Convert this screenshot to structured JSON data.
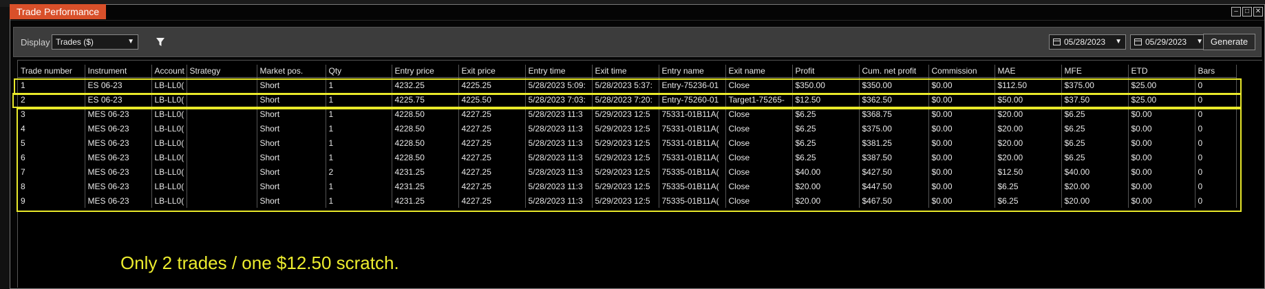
{
  "window": {
    "title": "Trade Performance"
  },
  "toolbar": {
    "display_label": "Display",
    "display_value": "Trades ($)",
    "filter_icon": "filter-icon",
    "date_from": "05/28/2023",
    "date_to": "05/29/2023",
    "generate_label": "Generate"
  },
  "table": {
    "columns": [
      "Trade number",
      "Instrument",
      "Account",
      "Strategy",
      "Market pos.",
      "Qty",
      "Entry price",
      "Exit price",
      "Entry time",
      "Exit time",
      "Entry name",
      "Exit name",
      "Profit",
      "Cum. net profit",
      "Commission",
      "MAE",
      "MFE",
      "ETD",
      "Bars"
    ],
    "rows": [
      [
        "1",
        "ES 06-23",
        "LB-LL0(",
        "",
        "Short",
        "1",
        "4232.25",
        "4225.25",
        "5/28/2023 5:09:",
        "5/28/2023 5:37:",
        "Entry-75236-01",
        "Close",
        "$350.00",
        "$350.00",
        "$0.00",
        "$112.50",
        "$375.00",
        "$25.00",
        "0"
      ],
      [
        "2",
        "ES 06-23",
        "LB-LL0(",
        "",
        "Short",
        "1",
        "4225.75",
        "4225.50",
        "5/28/2023 7:03:",
        "5/28/2023 7:20:",
        "Entry-75260-01",
        "Target1-75265-",
        "$12.50",
        "$362.50",
        "$0.00",
        "$50.00",
        "$37.50",
        "$25.00",
        "0"
      ],
      [
        "3",
        "MES 06-23",
        "LB-LL0(",
        "",
        "Short",
        "1",
        "4228.50",
        "4227.25",
        "5/28/2023 11:3",
        "5/29/2023 12:5",
        "75331-01B11A(",
        "Close",
        "$6.25",
        "$368.75",
        "$0.00",
        "$20.00",
        "$6.25",
        "$0.00",
        "0"
      ],
      [
        "4",
        "MES 06-23",
        "LB-LL0(",
        "",
        "Short",
        "1",
        "4228.50",
        "4227.25",
        "5/28/2023 11:3",
        "5/29/2023 12:5",
        "75331-01B11A(",
        "Close",
        "$6.25",
        "$375.00",
        "$0.00",
        "$20.00",
        "$6.25",
        "$0.00",
        "0"
      ],
      [
        "5",
        "MES 06-23",
        "LB-LL0(",
        "",
        "Short",
        "1",
        "4228.50",
        "4227.25",
        "5/28/2023 11:3",
        "5/29/2023 12:5",
        "75331-01B11A(",
        "Close",
        "$6.25",
        "$381.25",
        "$0.00",
        "$20.00",
        "$6.25",
        "$0.00",
        "0"
      ],
      [
        "6",
        "MES 06-23",
        "LB-LL0(",
        "",
        "Short",
        "1",
        "4228.50",
        "4227.25",
        "5/28/2023 11:3",
        "5/29/2023 12:5",
        "75331-01B11A(",
        "Close",
        "$6.25",
        "$387.50",
        "$0.00",
        "$20.00",
        "$6.25",
        "$0.00",
        "0"
      ],
      [
        "7",
        "MES 06-23",
        "LB-LL0(",
        "",
        "Short",
        "2",
        "4231.25",
        "4227.25",
        "5/28/2023 11:3",
        "5/29/2023 12:5",
        "75335-01B11A(",
        "Close",
        "$40.00",
        "$427.50",
        "$0.00",
        "$12.50",
        "$40.00",
        "$0.00",
        "0"
      ],
      [
        "8",
        "MES 06-23",
        "LB-LL0(",
        "",
        "Short",
        "1",
        "4231.25",
        "4227.25",
        "5/28/2023 11:3",
        "5/29/2023 12:5",
        "75335-01B11A(",
        "Close",
        "$20.00",
        "$447.50",
        "$0.00",
        "$6.25",
        "$20.00",
        "$0.00",
        "0"
      ],
      [
        "9",
        "MES 06-23",
        "LB-LL0(",
        "",
        "Short",
        "1",
        "4231.25",
        "4227.25",
        "5/28/2023 11:3",
        "5/29/2023 12:5",
        "75335-01B11A(",
        "Close",
        "$20.00",
        "$467.50",
        "$0.00",
        "$6.25",
        "$20.00",
        "$0.00",
        "0"
      ]
    ]
  },
  "annotation": {
    "text": "Only 2 trades / one $12.50 scratch."
  },
  "colors": {
    "title_tab": "#d9502a",
    "highlight": "#e9e92a",
    "annotation": "#ecec2e"
  }
}
